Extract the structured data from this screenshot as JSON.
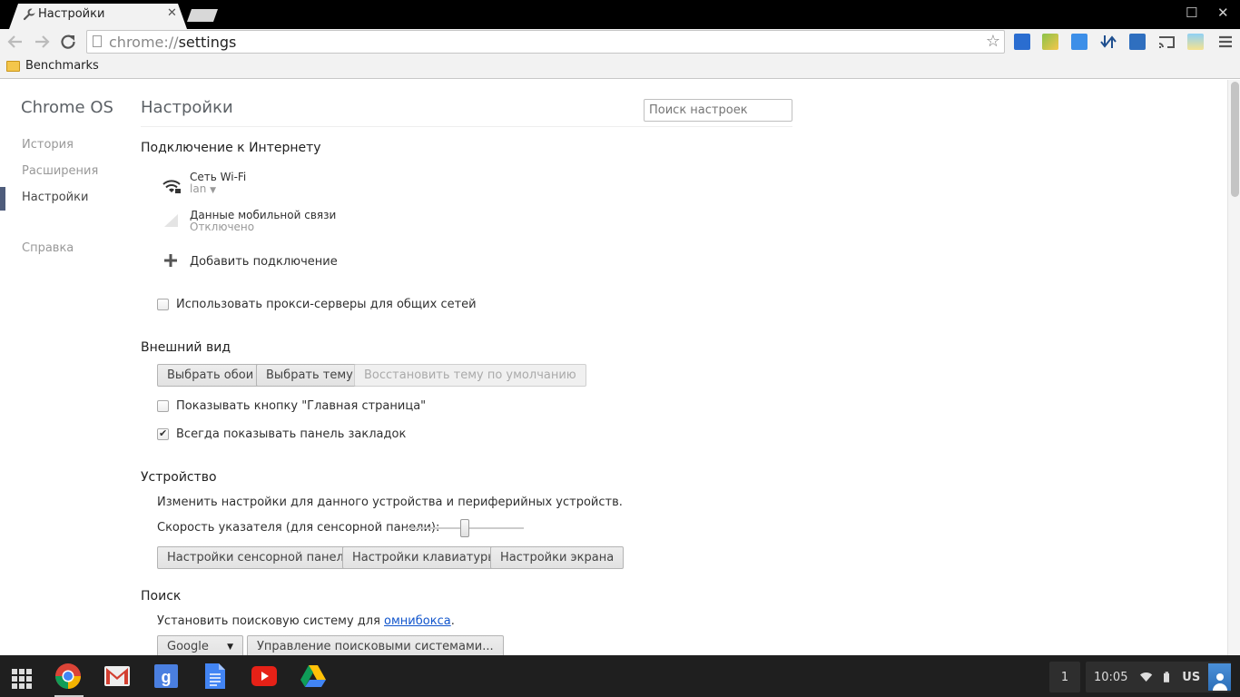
{
  "browser": {
    "tab_title": "Настройки",
    "tab_close": "✕",
    "url_scheme": "chrome://",
    "url_path": "settings",
    "bookmark_folder": "Benchmarks"
  },
  "sidebar": {
    "brand": "Chrome OS",
    "items": [
      {
        "label": "История"
      },
      {
        "label": "Расширения"
      },
      {
        "label": "Настройки"
      },
      {
        "label": "Справка"
      }
    ]
  },
  "page": {
    "title": "Настройки",
    "search_placeholder": "Поиск настроек"
  },
  "internet": {
    "heading": "Подключение к Интернету",
    "wifi_name": "Сеть Wi-Fi",
    "wifi_network": "lan",
    "mobile_name": "Данные мобильной связи",
    "mobile_status": "Отключено",
    "add_connection": "Добавить подключение",
    "proxy_label": "Использовать прокси-серверы для общих сетей",
    "proxy_checked": false
  },
  "appearance": {
    "heading": "Внешний вид",
    "btn_wallpaper": "Выбрать обои",
    "btn_theme": "Выбрать тему",
    "btn_reset_theme": "Восстановить тему по умолчанию",
    "home_button_label": "Показывать кнопку \"Главная страница\"",
    "home_button_checked": false,
    "bookmarks_bar_label": "Всегда показывать панель закладок",
    "bookmarks_bar_checked": true
  },
  "device": {
    "heading": "Устройство",
    "description": "Изменить настройки для данного устройства и периферийных устройств.",
    "pointer_speed_label": "Скорость указателя (для сенсорной панели):",
    "pointer_speed_fraction": 0.5,
    "btn_touchpad": "Настройки сенсорной панели",
    "btn_keyboard": "Настройки клавиатуры",
    "btn_display": "Настройки экрана"
  },
  "search": {
    "heading": "Поиск",
    "description_prefix": "Установить поисковую систему для ",
    "description_link": "омнибокса",
    "description_suffix": ".",
    "engine_selected": "Google",
    "btn_manage": "Управление поисковыми системами..."
  },
  "shelf": {
    "apps": [
      {
        "name": "chrome-app-icon"
      },
      {
        "name": "gmail-app-icon"
      },
      {
        "name": "google-search-app-icon"
      },
      {
        "name": "docs-app-icon"
      },
      {
        "name": "youtube-app-icon"
      },
      {
        "name": "drive-app-icon"
      }
    ],
    "notification_count": "1",
    "clock": "10:05",
    "keyboard_layout": "US"
  },
  "colors": {
    "accent": "#4e5c7b",
    "link": "#1155cc",
    "shelf": "#1f1f1f"
  }
}
